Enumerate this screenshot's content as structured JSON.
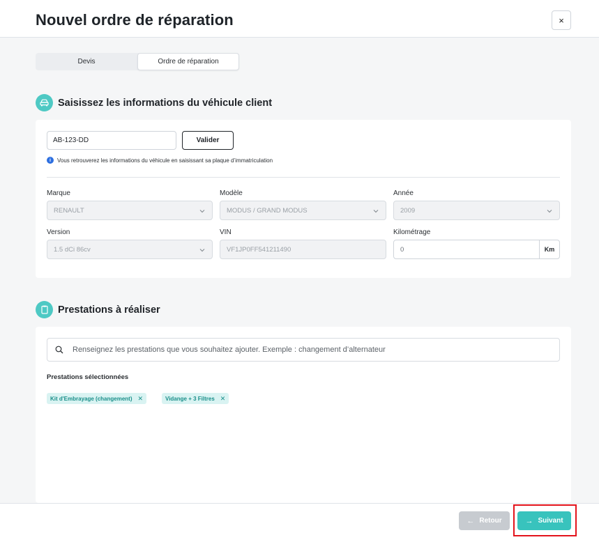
{
  "header": {
    "title": "Nouvel ordre de réparation",
    "close_icon": "×"
  },
  "tabs": [
    {
      "label": "Devis"
    },
    {
      "label": "Ordre de réparation",
      "active": true
    }
  ],
  "vehicle": {
    "title": "Saisissez les informations du véhicule client",
    "icon": "car-icon",
    "plate_value": "AB-123-DD",
    "validate_label": "Valider",
    "hint": "Vous retrouverez les informations du véhicule en saisissant sa plaque d’immatriculation",
    "fields": {
      "brand": {
        "label": "Marque",
        "value": "RENAULT"
      },
      "model": {
        "label": "Modèle",
        "value": "MODUS / GRAND MODUS"
      },
      "year": {
        "label": "Année",
        "value": "2009"
      },
      "version": {
        "label": "Version",
        "value": "1.5 dCi 86cv"
      },
      "vin": {
        "label": "VIN",
        "value": "VF1JP0FF541211490"
      },
      "mileage": {
        "label": "Kilométrage",
        "value": "0",
        "unit": "Km"
      }
    }
  },
  "services": {
    "title": "Prestations à réaliser",
    "icon": "clipboard-icon",
    "search_placeholder": "Renseignez les prestations que vous souhaitez ajouter. Exemple : changement d’alternateur",
    "selected_label": "Prestations sélectionnées",
    "selected": [
      {
        "label": "Kit d'Embrayage (changement)"
      },
      {
        "label": "Vidange + 3 Filtres"
      }
    ]
  },
  "footer": {
    "back_label": "Retour",
    "next_label": "Suivant"
  },
  "colors": {
    "accent": "#38c3bd",
    "chip_bg": "#d9f3f2",
    "highlight": "#e3131b"
  }
}
